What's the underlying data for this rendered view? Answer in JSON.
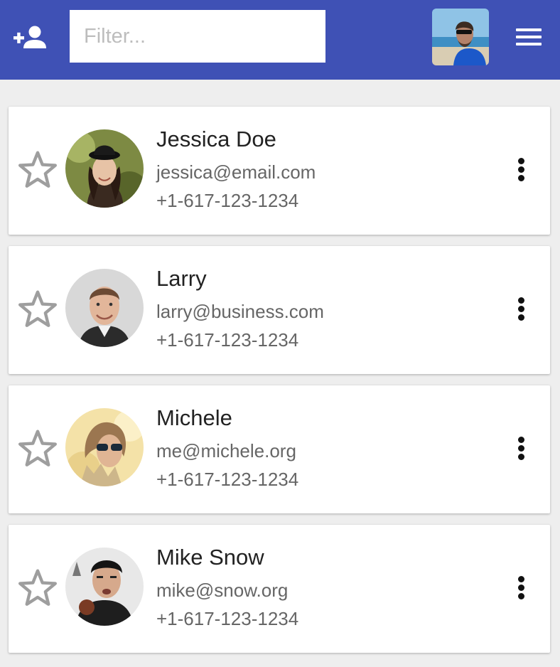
{
  "header": {
    "add_contact_icon": "person-add-icon",
    "filter_placeholder": "Filter...",
    "filter_value": "",
    "menu_icon": "hamburger-menu-icon",
    "accent_color": "#3f51b5"
  },
  "contacts": [
    {
      "name": "Jessica Doe",
      "email": "jessica@email.com",
      "phone": "+1-617-123-1234",
      "starred": false
    },
    {
      "name": "Larry",
      "email": "larry@business.com",
      "phone": "+1-617-123-1234",
      "starred": false
    },
    {
      "name": "Michele",
      "email": "me@michele.org",
      "phone": "+1-617-123-1234",
      "starred": false
    },
    {
      "name": "Mike Snow",
      "email": "mike@snow.org",
      "phone": "+1-617-123-1234",
      "starred": false
    }
  ]
}
